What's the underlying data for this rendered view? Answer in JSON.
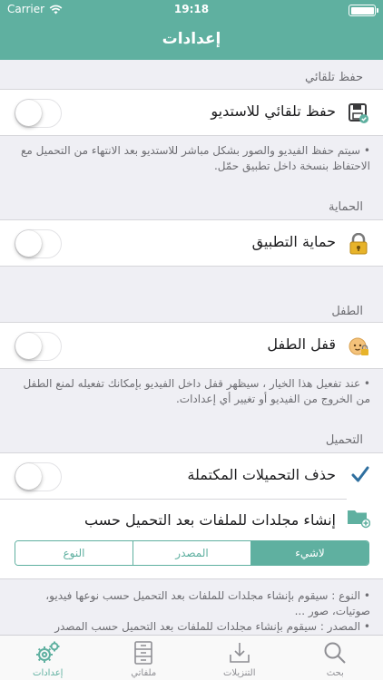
{
  "status": {
    "carrier": "Carrier",
    "time": "19:18"
  },
  "nav": {
    "title": "إعدادات"
  },
  "sections": {
    "autosave": {
      "header": "حفظ تلقائي",
      "row_label": "حفظ تلقائي للاستديو",
      "note": "• سيتم حفظ الفيديو والصور بشكل مباشر للاستديو بعد الانتهاء من التحميل مع الاحتفاظ بنسخة داخل تطبيق حمّل."
    },
    "protection": {
      "header": "الحماية",
      "row_label": "حماية التطبيق"
    },
    "child": {
      "header": "الطفل",
      "row_label": "قفل الطفل",
      "note": "• عند تفعيل هذا الخيار ، سيظهر قفل داخل الفيديو بإمكانك تفعيله لمنع الطفل من الخروج من الفيديو أو تغيير أي إعدادات."
    },
    "download": {
      "header": "التحميل",
      "delete_label": "حذف التحميلات المكتملة",
      "folders_label": "إنشاء مجلدات للملفات بعد التحميل حسب",
      "segments": [
        "لاشيء",
        "المصدر",
        "النوع"
      ],
      "selected_segment": "لاشيء",
      "note1": "• النوع : سيقوم بإنشاء مجلدات للملفات بعد التحميل حسب نوعها فيديو، صوتيات، صور ...",
      "note2": "• المصدر : سيقوم بإنشاء مجلدات للملفات بعد التحميل حسب المصدر"
    }
  },
  "toggles": {
    "autosave": false,
    "protection": false,
    "child_lock": false,
    "delete_completed": false
  },
  "tabs": [
    "بحث",
    "التنزيلات",
    "ملفاتي",
    "إعدادات"
  ],
  "active_tab": "إعدادات",
  "colors": {
    "accent": "#5fb0a0",
    "background": "#efeff4",
    "checkmark": "#2f6f9f"
  }
}
